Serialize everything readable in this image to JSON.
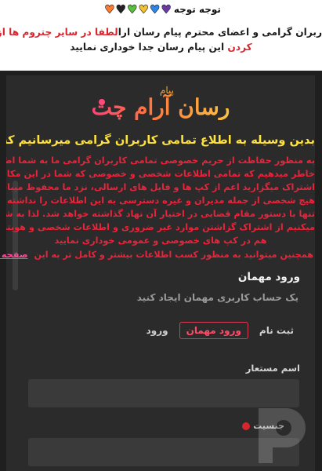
{
  "notice": {
    "attention": "توجه توجه",
    "hearts": [
      "#6b3aa8",
      "#2f86e8",
      "#f2c230",
      "#58c03a",
      "#222222",
      "#ff7a2c"
    ],
    "line1_black": "ربران گرامی و اعضای محترم پیام رسان ارا",
    "line1_red": "لطفا در سایر چتروم ها از بردن نام ما و یا تبلیغ",
    "line2_red": "کردن",
    "line2_black": "این پیام رسان جدا خوداری نمایید"
  },
  "logo": {
    "small": "پیام",
    "main": "رسان آرام چت"
  },
  "announcement": {
    "heading": "بدین وسیله به اطلاع تمامی کاربران گرامی میرسانیم که",
    "heading_colon": " :",
    "body_lines": [
      "به منظور حفاظت از حریم خصوصی تمامی کاربران گرامی ما به شما اطمینان",
      "خاطر میدهیم که تمامی اطلاعات شخصی و خصوصی که شما در این مکان به",
      "اشتراک میگزارید اعم از کپ ها و فایل های ارسالی، نزد ما محفوظ میباشد و",
      "هیچ شخصی از جمله مدیران و غیره دسترسی به این اطلاعات را نداشته و",
      "تنها با دستور مقام قضایی در اختیار آن نهاد گذاشته خواهد شد. لذا به شما توصیه",
      "میکنیم از اشتراک گزاشتن موارد غیر ضروری و اطلاعات شخصی و هویتی و امثال",
      "هم در کپ های خصوصی و عمومی خوداری نمایید"
    ],
    "note": "همچنین میتوانید به منظور کسب اطلاعات بیشتر و کامل تر به این",
    "note_link": "صفحه مراجعه"
  },
  "guest": {
    "title": "ورود مهمان",
    "subtitle": "یک حساب کاربری مهمان ایجاد کنید",
    "tabs": [
      {
        "label": "ورود",
        "active": false
      },
      {
        "label": "ورود مهمان",
        "active": true
      },
      {
        "label": "ثبت نام",
        "active": false
      }
    ],
    "username_label": "اسم مستعار",
    "username_value": "",
    "gender_label": "جنسیت"
  },
  "colors": {
    "accent": "#d83a52",
    "warning_red": "#e9233a",
    "heading_yellow": "#ffe33a",
    "link_pink": "#ff4a96",
    "app_bg": "#2b2b2b"
  }
}
